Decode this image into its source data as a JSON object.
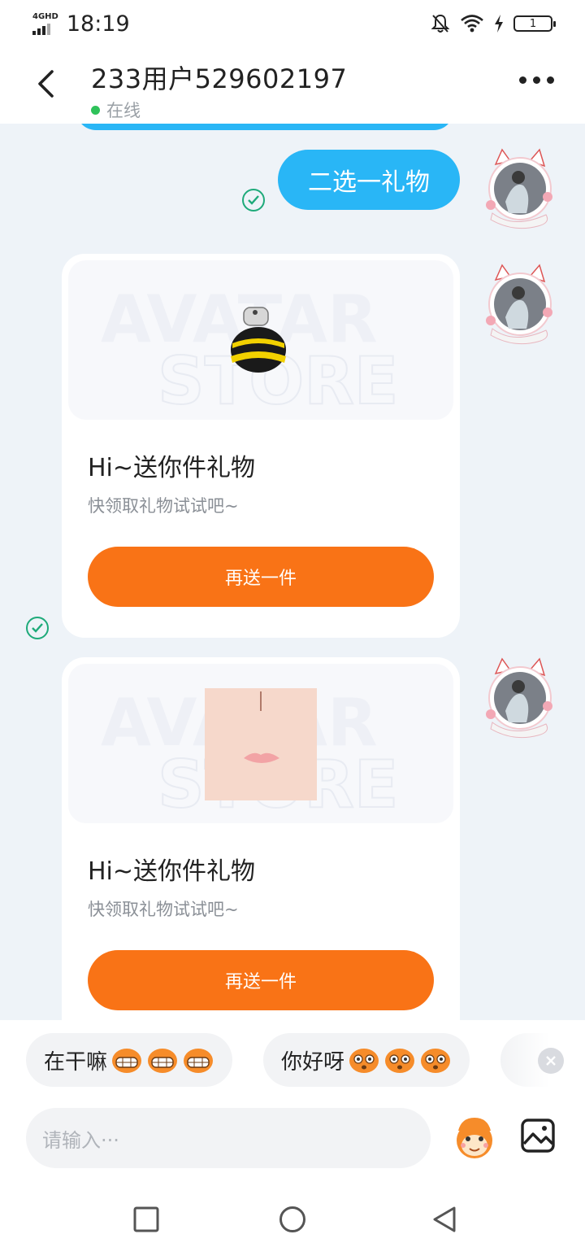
{
  "status_bar": {
    "network": "4GHD",
    "time": "18:19",
    "battery": "1"
  },
  "header": {
    "title": "233用户529602197",
    "status": "在线"
  },
  "messages": {
    "text_bubble": "二选一礼物",
    "gift_cards": [
      {
        "title": "Hi~送你件礼物",
        "subtitle": "快领取礼物试试吧~",
        "button": "再送一件"
      },
      {
        "title": "Hi~送你件礼物",
        "subtitle": "快领取礼物试试吧~",
        "button": "再送一件"
      }
    ],
    "watermark": [
      "AVATAR",
      "STORE"
    ]
  },
  "quick_replies": [
    {
      "label": "在干嘛"
    },
    {
      "label": "你好呀"
    }
  ],
  "input": {
    "placeholder": "请输入···"
  },
  "colors": {
    "accent_blue": "#29b6f6",
    "accent_orange": "#f97316",
    "online_green": "#2ec25a",
    "check_green": "#1eaa7a"
  },
  "icons": {
    "back": "chevron-left-icon",
    "more": "more-dots-icon",
    "emoji": "emoji-face-icon",
    "image": "image-icon",
    "nav_recent": "square-icon",
    "nav_home": "circle-icon",
    "nav_back": "triangle-back-icon"
  }
}
